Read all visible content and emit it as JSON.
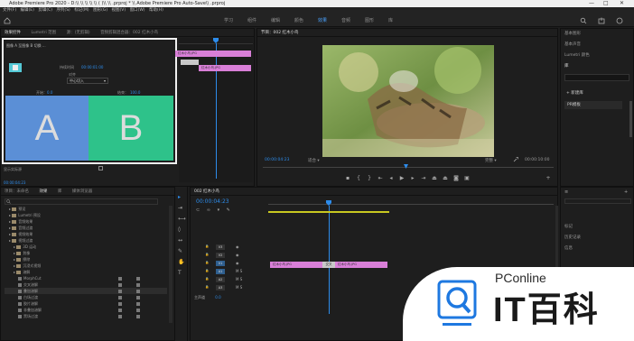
{
  "window": {
    "title": "Adobe Premiere Pro 2020 - D:\\\\ \\\\ \\\\ \\\\ \\\\ (     )\\\\   \\\\ .prproj *  \\\\ Adobe Premiere Pro Auto-Save\\\\ .prproj",
    "minimize": "—",
    "maximize": "□",
    "close": "✕"
  },
  "menubar": [
    "文件(F)",
    "编辑(E)",
    "剪辑(C)",
    "序列(S)",
    "标记(M)",
    "图形(G)",
    "视图(V)",
    "窗口(W)",
    "帮助(H)"
  ],
  "workspaces": [
    "学习",
    "组件",
    "编辑",
    "颜色",
    "效果",
    "音频",
    "图形",
    "库"
  ],
  "active_workspace": "效果",
  "effect_controls": {
    "tabs": [
      "效果控件",
      "Lumetri 范围",
      "源：(无剪辑)",
      "音频剪辑混合器：002 红木小鸟"
    ],
    "clip_label": "图像 A 至图像 B 切换 ...",
    "duration_label": "持续时间",
    "duration_value": "00:00:01:00",
    "alignment_label": "对齐",
    "alignment_value": "中心切入",
    "start_label": "开始：",
    "start_value": "0.0",
    "end_label": "结束：",
    "end_value": "100.0",
    "panel_a": "A",
    "panel_b": "B",
    "show_actual_source": "显示实际源",
    "timecode": "00:00:04:23"
  },
  "ec_mini_timeline": {
    "clip1": "红木小鸟.JPG",
    "clip2": "红木小鸟.JPG"
  },
  "program": {
    "title": "节目：002 红木小鸟",
    "timecode": "00:00:04:23",
    "fit": "适合",
    "quality": "完整",
    "duration": "00:00:10:00"
  },
  "right_panel": {
    "items": [
      "基本图形",
      "基本声音",
      "Lumetri 颜色",
      "库"
    ],
    "add_label": "新建库",
    "library_item": "PR模板",
    "bottom_items": [
      "标记",
      "历史记录",
      "信息"
    ]
  },
  "project": {
    "tabs": [
      "项目：未命名",
      "效果",
      "库",
      "媒体浏览器"
    ],
    "tree": [
      {
        "label": "预设",
        "indent": 1,
        "icon": "folder"
      },
      {
        "label": "Lumetri 预设",
        "indent": 1,
        "icon": "folder"
      },
      {
        "label": "音频效果",
        "indent": 1,
        "icon": "folder"
      },
      {
        "label": "音频过渡",
        "indent": 1,
        "icon": "folder"
      },
      {
        "label": "视频效果",
        "indent": 1,
        "icon": "folder"
      },
      {
        "label": "视频过渡",
        "indent": 1,
        "icon": "folder"
      },
      {
        "label": "3D 运动",
        "indent": 2,
        "icon": "folder"
      },
      {
        "label": "划像",
        "indent": 2,
        "icon": "folder"
      },
      {
        "label": "擦除",
        "indent": 2,
        "icon": "folder"
      },
      {
        "label": "沉浸式视频",
        "indent": 2,
        "icon": "folder"
      },
      {
        "label": "溶解",
        "indent": 2,
        "icon": "folder"
      },
      {
        "label": "MorphCut",
        "indent": 3,
        "icon": "fx"
      },
      {
        "label": "交叉溶解",
        "indent": 3,
        "icon": "fx"
      },
      {
        "label": "叠加溶解",
        "indent": 3,
        "icon": "fx"
      },
      {
        "label": "白场过渡",
        "indent": 3,
        "icon": "fx"
      },
      {
        "label": "胶片溶解",
        "indent": 3,
        "icon": "fx"
      },
      {
        "label": "非叠加溶解",
        "indent": 3,
        "icon": "fx"
      },
      {
        "label": "黑场过渡",
        "indent": 3,
        "icon": "fx"
      }
    ]
  },
  "timeline": {
    "title": "002 红木小鸟",
    "timecode": "00:00:04:23",
    "tracks": [
      "V3",
      "V2",
      "V1",
      "A1",
      "A2",
      "A3"
    ],
    "master_label": "主声道",
    "master_value": "0.0",
    "clip1": "红木小鸟.JPG",
    "clip2": "红木小鸟.JPG",
    "transition": "交叉"
  },
  "watermark": {
    "brand": "PConline",
    "cn": "IT百科"
  },
  "colors": {
    "accent": "#2d8ceb",
    "clip": "#d97fd8",
    "panel_a": "#5b8fd6",
    "panel_b": "#2ec28a",
    "swatch": "#55c9d6"
  }
}
